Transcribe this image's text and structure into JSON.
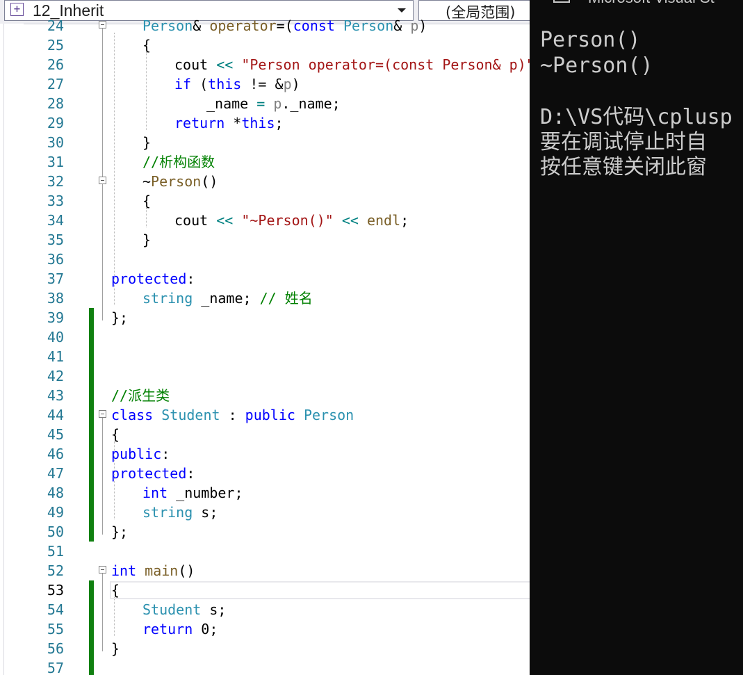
{
  "editor": {
    "project": "12_Inherit",
    "scope": "(全局范围)",
    "lines": [
      {
        "n": "24",
        "segs": [
          {
            "t": "Person",
            "c": "ty"
          },
          {
            "t": "& ",
            "c": ""
          },
          {
            "t": "operator",
            "c": "fn"
          },
          {
            "t": "=(",
            "c": ""
          },
          {
            "t": "const ",
            "c": "kw"
          },
          {
            "t": "Person",
            "c": "ty"
          },
          {
            "t": "& ",
            "c": ""
          },
          {
            "t": "p",
            "c": "pm"
          },
          {
            "t": ")",
            "c": ""
          }
        ]
      },
      {
        "n": "25",
        "segs": [
          {
            "t": "{",
            "c": ""
          }
        ]
      },
      {
        "n": "26",
        "segs": [
          {
            "t": "cout ",
            "c": ""
          },
          {
            "t": "<< ",
            "c": "op"
          },
          {
            "t": "\"Person operator=(const Person& p)\"",
            "c": "st"
          },
          {
            "t": " <",
            "c": "op"
          }
        ]
      },
      {
        "n": "27",
        "segs": [
          {
            "t": "if ",
            "c": "kw"
          },
          {
            "t": "(",
            "c": ""
          },
          {
            "t": "this",
            "c": "kw"
          },
          {
            "t": " != &",
            "c": ""
          },
          {
            "t": "p",
            "c": "pm"
          },
          {
            "t": ")",
            "c": ""
          }
        ]
      },
      {
        "n": "28",
        "segs": [
          {
            "t": "_name ",
            "c": ""
          },
          {
            "t": "= ",
            "c": "op"
          },
          {
            "t": "p",
            "c": "pm"
          },
          {
            "t": "._name;",
            "c": ""
          }
        ]
      },
      {
        "n": "29",
        "segs": [
          {
            "t": "return ",
            "c": "kw"
          },
          {
            "t": "*",
            "c": ""
          },
          {
            "t": "this",
            "c": "kw"
          },
          {
            "t": ";",
            "c": ""
          }
        ]
      },
      {
        "n": "30",
        "segs": [
          {
            "t": "}",
            "c": ""
          }
        ]
      },
      {
        "n": "31",
        "segs": [
          {
            "t": "//析构函数",
            "c": "cm"
          }
        ]
      },
      {
        "n": "32",
        "segs": [
          {
            "t": "~",
            "c": ""
          },
          {
            "t": "Person",
            "c": "fn"
          },
          {
            "t": "()",
            "c": ""
          }
        ]
      },
      {
        "n": "33",
        "segs": [
          {
            "t": "{",
            "c": ""
          }
        ]
      },
      {
        "n": "34",
        "segs": [
          {
            "t": "cout ",
            "c": ""
          },
          {
            "t": "<< ",
            "c": "op"
          },
          {
            "t": "\"~Person()\"",
            "c": "st"
          },
          {
            "t": " << ",
            "c": "op"
          },
          {
            "t": "endl",
            "c": "fn"
          },
          {
            "t": ";",
            "c": ""
          }
        ]
      },
      {
        "n": "35",
        "segs": [
          {
            "t": "}",
            "c": ""
          }
        ]
      },
      {
        "n": "36",
        "segs": []
      },
      {
        "n": "37",
        "segs": [
          {
            "t": "protected",
            "c": "kw"
          },
          {
            "t": ":",
            "c": ""
          }
        ]
      },
      {
        "n": "38",
        "segs": [
          {
            "t": "string ",
            "c": "ty"
          },
          {
            "t": "_name; ",
            "c": ""
          },
          {
            "t": "// 姓名",
            "c": "cm"
          }
        ]
      },
      {
        "n": "39",
        "segs": [
          {
            "t": "};",
            "c": ""
          }
        ]
      },
      {
        "n": "40",
        "segs": []
      },
      {
        "n": "41",
        "segs": []
      },
      {
        "n": "42",
        "segs": []
      },
      {
        "n": "43",
        "segs": [
          {
            "t": "//派生类",
            "c": "cm"
          }
        ]
      },
      {
        "n": "44",
        "segs": [
          {
            "t": "class ",
            "c": "kw"
          },
          {
            "t": "Student",
            "c": "ty"
          },
          {
            "t": " : ",
            "c": ""
          },
          {
            "t": "public ",
            "c": "kw"
          },
          {
            "t": "Person",
            "c": "ty"
          }
        ]
      },
      {
        "n": "45",
        "segs": [
          {
            "t": "{",
            "c": ""
          }
        ]
      },
      {
        "n": "46",
        "segs": [
          {
            "t": "public",
            "c": "kw"
          },
          {
            "t": ":",
            "c": ""
          }
        ]
      },
      {
        "n": "47",
        "segs": [
          {
            "t": "protected",
            "c": "kw"
          },
          {
            "t": ":",
            "c": ""
          }
        ]
      },
      {
        "n": "48",
        "segs": [
          {
            "t": "int ",
            "c": "kw"
          },
          {
            "t": "_number;",
            "c": ""
          }
        ]
      },
      {
        "n": "49",
        "segs": [
          {
            "t": "string ",
            "c": "ty"
          },
          {
            "t": "s;",
            "c": ""
          }
        ]
      },
      {
        "n": "50",
        "segs": [
          {
            "t": "};",
            "c": ""
          }
        ]
      },
      {
        "n": "51",
        "segs": []
      },
      {
        "n": "52",
        "segs": [
          {
            "t": "int ",
            "c": "kw"
          },
          {
            "t": "main",
            "c": "fn"
          },
          {
            "t": "()",
            "c": ""
          }
        ]
      },
      {
        "n": "53",
        "segs": [
          {
            "t": "{",
            "c": ""
          }
        ]
      },
      {
        "n": "54",
        "segs": [
          {
            "t": "Student ",
            "c": "ty"
          },
          {
            "t": "s;",
            "c": ""
          }
        ]
      },
      {
        "n": "55",
        "segs": [
          {
            "t": "return ",
            "c": "kw"
          },
          {
            "t": "0;",
            "c": ""
          }
        ]
      },
      {
        "n": "56",
        "segs": [
          {
            "t": "}",
            "c": ""
          }
        ]
      },
      {
        "n": "57",
        "segs": []
      }
    ]
  },
  "console": {
    "title": "Microsoft Visual St",
    "lines": [
      "Person()",
      "~Person()",
      "",
      "D:\\VS代码\\cplusp",
      "要在调试停止时自",
      "按任意键关闭此窗"
    ]
  },
  "colors": {
    "change_bar": "#108010",
    "console_bg": "#0c0c0c",
    "console_text": "#cccccc",
    "line_number": "#237893"
  }
}
